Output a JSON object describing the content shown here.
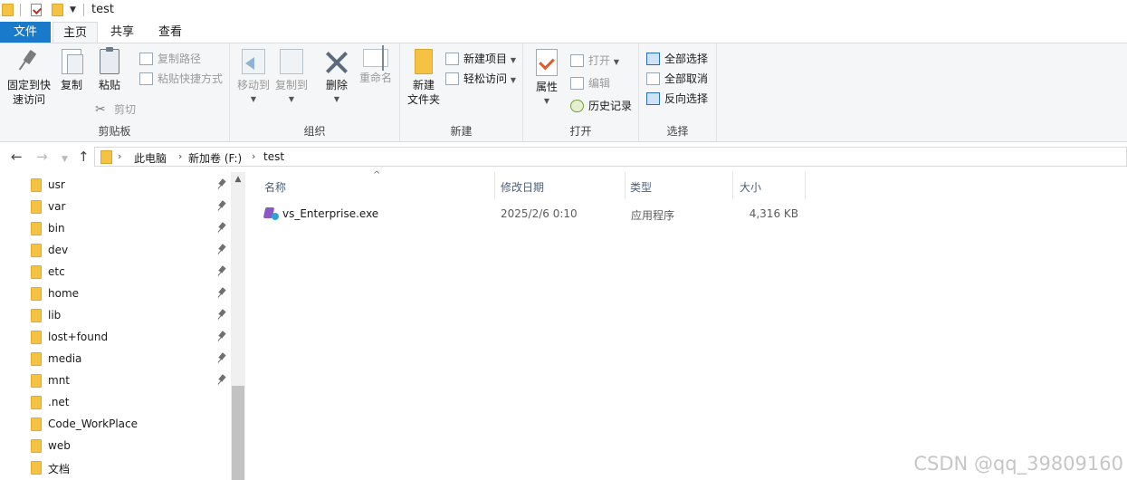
{
  "title": "test",
  "tabs": {
    "file": "文件",
    "home": "主页",
    "share": "共享",
    "view": "查看"
  },
  "ribbon": {
    "clipboard": {
      "label": "剪贴板",
      "pin_line1": "固定到快",
      "pin_line2": "速访问",
      "copy": "复制",
      "paste": "粘贴",
      "copy_path": "复制路径",
      "paste_shortcut": "粘贴快捷方式",
      "cut": "剪切"
    },
    "organize": {
      "label": "组织",
      "move_to": "移动到",
      "copy_to": "复制到",
      "delete": "删除",
      "rename": "重命名"
    },
    "new": {
      "label": "新建",
      "new_folder_line1": "新建",
      "new_folder_line2": "文件夹",
      "new_item": "新建项目",
      "easy_access": "轻松访问"
    },
    "open": {
      "label": "打开",
      "properties": "属性",
      "open": "打开",
      "edit": "编辑",
      "history": "历史记录"
    },
    "select": {
      "label": "选择",
      "select_all": "全部选择",
      "select_none": "全部取消",
      "invert": "反向选择"
    }
  },
  "address": {
    "crumbs": [
      "此电脑",
      "新加卷 (F:)",
      "test"
    ]
  },
  "nav_items": [
    {
      "label": "usr",
      "pinned": true
    },
    {
      "label": "var",
      "pinned": true
    },
    {
      "label": "bin",
      "pinned": true
    },
    {
      "label": "dev",
      "pinned": true
    },
    {
      "label": "etc",
      "pinned": true
    },
    {
      "label": "home",
      "pinned": true
    },
    {
      "label": "lib",
      "pinned": true
    },
    {
      "label": "lost+found",
      "pinned": true
    },
    {
      "label": "media",
      "pinned": true
    },
    {
      "label": "mnt",
      "pinned": true
    },
    {
      "label": ".net",
      "pinned": false
    },
    {
      "label": "Code_WorkPlace",
      "pinned": false
    },
    {
      "label": "web",
      "pinned": false
    },
    {
      "label": "文档",
      "pinned": false
    }
  ],
  "columns": {
    "name": "名称",
    "date": "修改日期",
    "type": "类型",
    "size": "大小"
  },
  "files": [
    {
      "name": "vs_Enterprise.exe",
      "date": "2025/2/6 0:10",
      "type": "应用程序",
      "size": "4,316 KB"
    }
  ],
  "watermark": "CSDN @qq_39809160",
  "colors": {
    "file_tab": "#1979ca",
    "folder": "#f5c243",
    "ribbon_bg": "#f5f6f7"
  }
}
